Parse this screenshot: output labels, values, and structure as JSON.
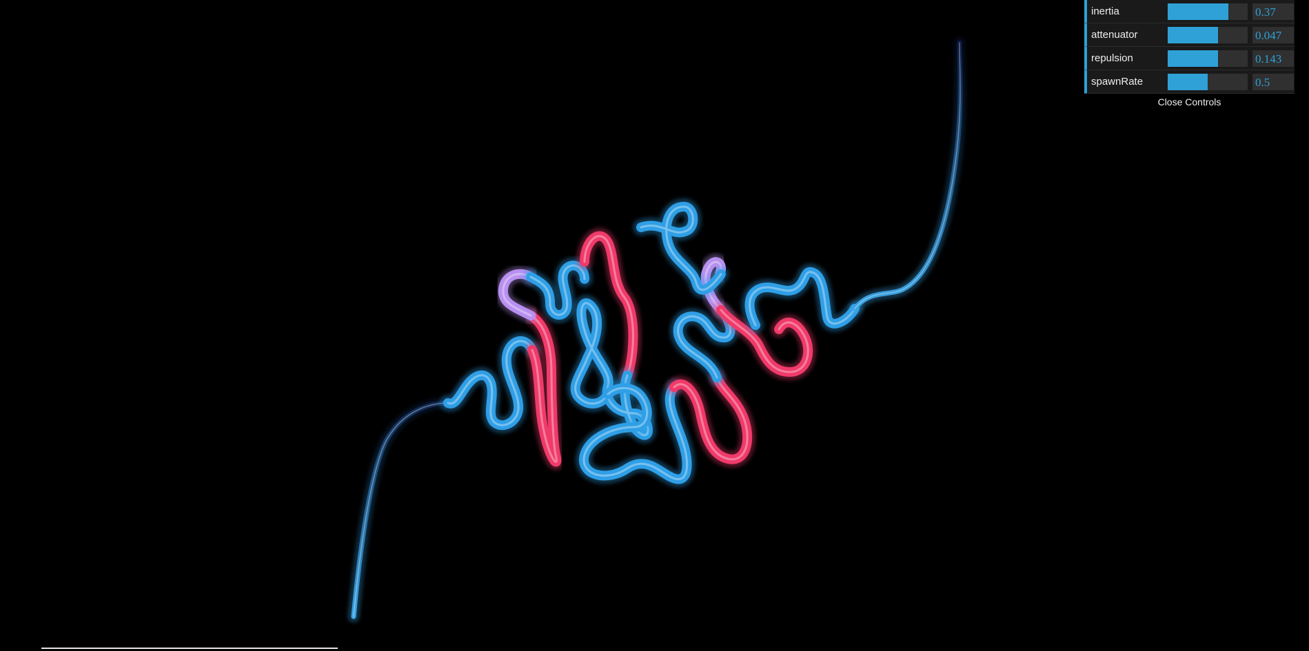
{
  "controls": {
    "items": [
      {
        "label": "inertia",
        "value": "0.37",
        "fill": 0.76
      },
      {
        "label": "attenuator",
        "value": "0.047",
        "fill": 0.63
      },
      {
        "label": "repulsion",
        "value": "0.143",
        "fill": 0.63
      },
      {
        "label": "spawnRate",
        "value": "0.5",
        "fill": 0.5
      }
    ],
    "close_label": "Close Controls"
  },
  "colors": {
    "accent": "#2fa1d6",
    "panel_bg": "#1a1a1a",
    "slider_track": "#303030",
    "curve_blue": "#2f9fe6",
    "curve_pink": "#f03a6a",
    "curve_lavender": "#b890f0"
  }
}
